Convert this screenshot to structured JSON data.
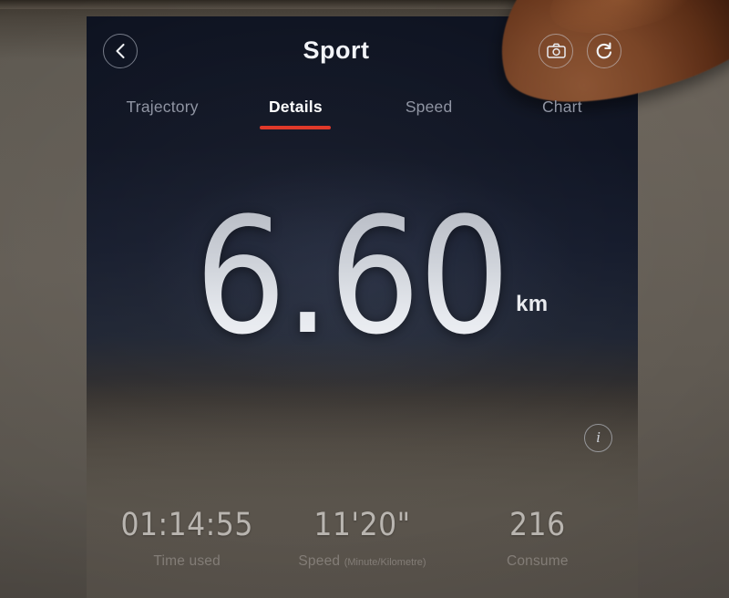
{
  "appbar": {
    "back_icon": "chevron-left-icon",
    "title": "Sport",
    "camera_icon": "camera-icon",
    "refresh_icon": "refresh-icon"
  },
  "tabs": [
    {
      "label": "Trajectory",
      "active": false
    },
    {
      "label": "Details",
      "active": true
    },
    {
      "label": "Speed",
      "active": false
    },
    {
      "label": "Chart",
      "active": false
    }
  ],
  "hero": {
    "distance_value": "6.60",
    "distance_unit": "km"
  },
  "info": {
    "icon": "info-icon",
    "glyph": "i"
  },
  "stats": [
    {
      "value": "01:14:55",
      "label": "Time used",
      "sub": ""
    },
    {
      "value": "11'20\"",
      "label": "Speed ",
      "sub": "(Minute/Kilometre)"
    },
    {
      "value": "216",
      "label": "Consume",
      "sub": ""
    }
  ],
  "colors": {
    "accent_red": "#e0392a",
    "screen_top": "#0d1220",
    "screen_bottom": "#554f47",
    "backdrop": "#635d55",
    "value_text": "#e6e9ee",
    "tab_inactive": "#9095a3",
    "stat_value": "#b9b5b0",
    "stat_label": "#837d77"
  }
}
